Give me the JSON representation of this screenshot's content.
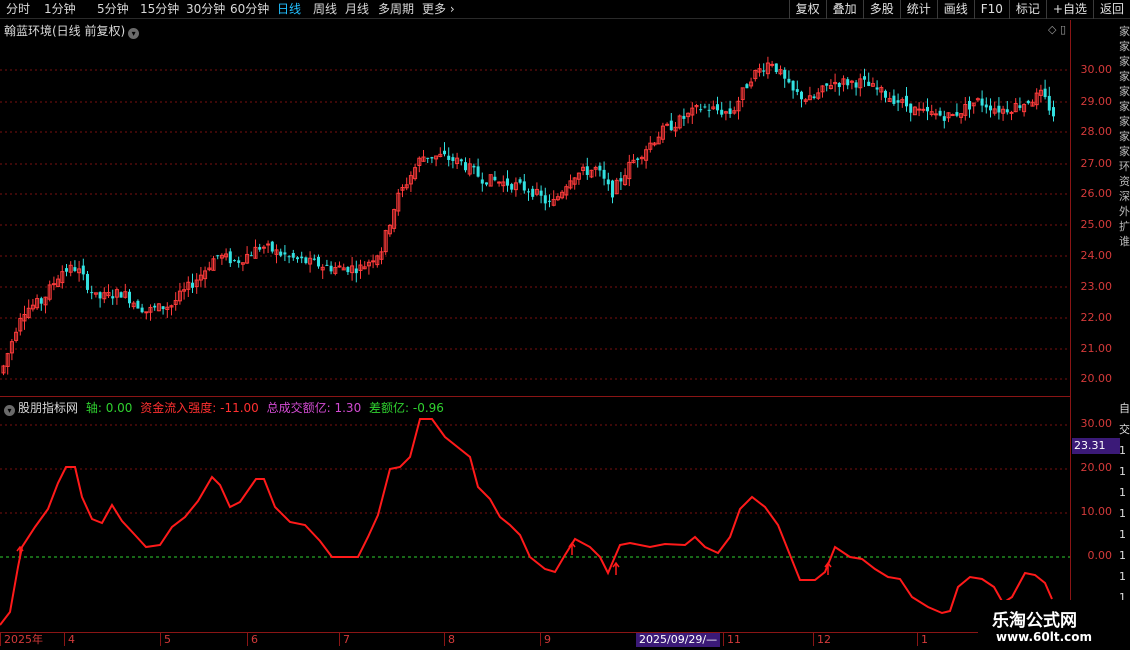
{
  "toolbar": {
    "timeframes": [
      "分时",
      "1分钟",
      "5分钟",
      "15分钟",
      "30分钟",
      "60分钟",
      "日线",
      "周线",
      "月线",
      "多周期",
      "更多"
    ],
    "active": "日线",
    "more_arrow": "›",
    "buttons": [
      "复权",
      "叠加",
      "多股",
      "统计",
      "画线",
      "F10",
      "标记",
      "+自选",
      "返回"
    ]
  },
  "price_pane": {
    "title": "翰蓝环境(日线 前复权)",
    "icons": "◇ ▯",
    "y_ticks": [
      "30.00",
      "29.00",
      "28.00",
      "27.00",
      "26.00",
      "25.00",
      "24.00",
      "23.00",
      "22.00",
      "21.00",
      "20.00"
    ]
  },
  "indicator_pane": {
    "name": "股朋指标网",
    "fields": [
      {
        "label": "轴: 0.00",
        "color": "#2fd12f"
      },
      {
        "label": "资金流入强度: -11.00",
        "color": "#ff3030"
      },
      {
        "label": "总成交额亿: 1.30",
        "color": "#d24bd2"
      },
      {
        "label": "差额亿: -0.96",
        "color": "#2fd12f"
      }
    ],
    "y_ticks": [
      "30.00",
      "20.00",
      "10.00",
      "0.00"
    ],
    "current_value": "23.31"
  },
  "x_axis": {
    "labels": [
      "2025年",
      "4",
      "5",
      "6",
      "7",
      "8",
      "9",
      "11",
      "12",
      "1"
    ],
    "cursor_label": "2025/09/29/—"
  },
  "side_strip": {
    "top_text": "家家家家家家家家家环资深外扩谁",
    "bottom_text": "自交111111111"
  },
  "watermark": {
    "title": "乐淘公式网",
    "url": "www.60lt.com"
  },
  "colors": {
    "up_candle": "#ff3b3b",
    "down_candle": "#33e0e0",
    "indicator_line": "#ff1a1a",
    "zero_line": "#2fd12f",
    "grid": "#7a1010"
  }
}
